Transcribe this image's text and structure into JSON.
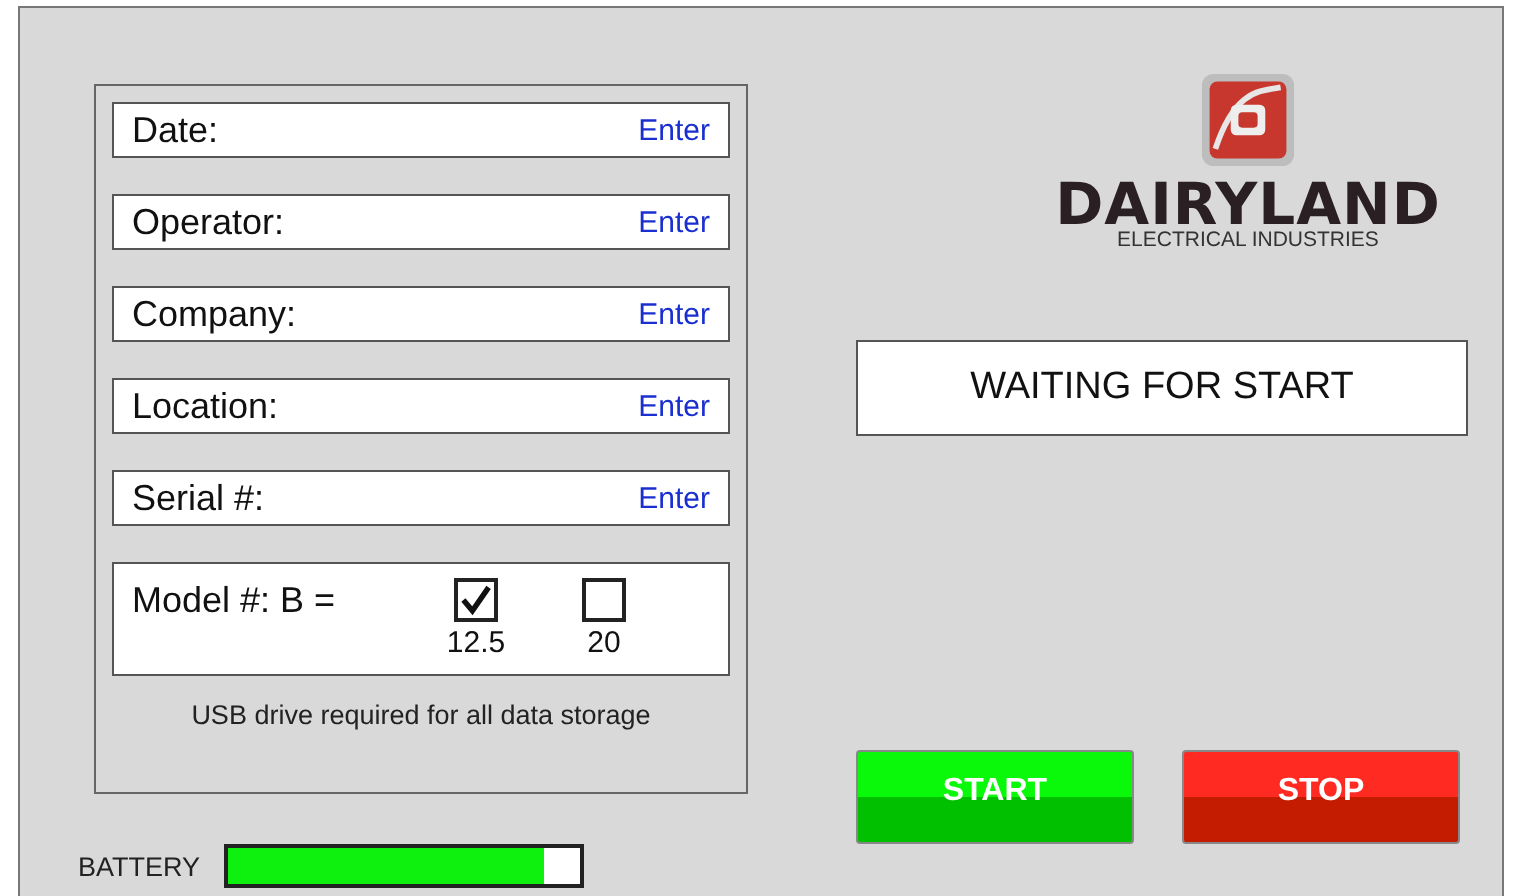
{
  "form": {
    "fields": [
      {
        "label": "Date:",
        "action": "Enter"
      },
      {
        "label": "Operator:",
        "action": "Enter"
      },
      {
        "label": "Company:",
        "action": "Enter"
      },
      {
        "label": "Location:",
        "action": "Enter"
      },
      {
        "label": "Serial #:",
        "action": "Enter"
      }
    ],
    "model": {
      "label": "Model #: B =",
      "options": [
        {
          "label": "12.5",
          "checked": true
        },
        {
          "label": "20",
          "checked": false
        }
      ]
    },
    "note": "USB drive required for all data storage"
  },
  "battery": {
    "label": "BATTERY",
    "level": 0.9
  },
  "logo": {
    "name": "DAIRYLAND",
    "subtitle": "ELECTRICAL INDUSTRIES"
  },
  "status": "WAITING FOR START",
  "buttons": [
    {
      "label": "START",
      "kind": "start"
    },
    {
      "label": "STOP",
      "kind": "stop"
    }
  ]
}
